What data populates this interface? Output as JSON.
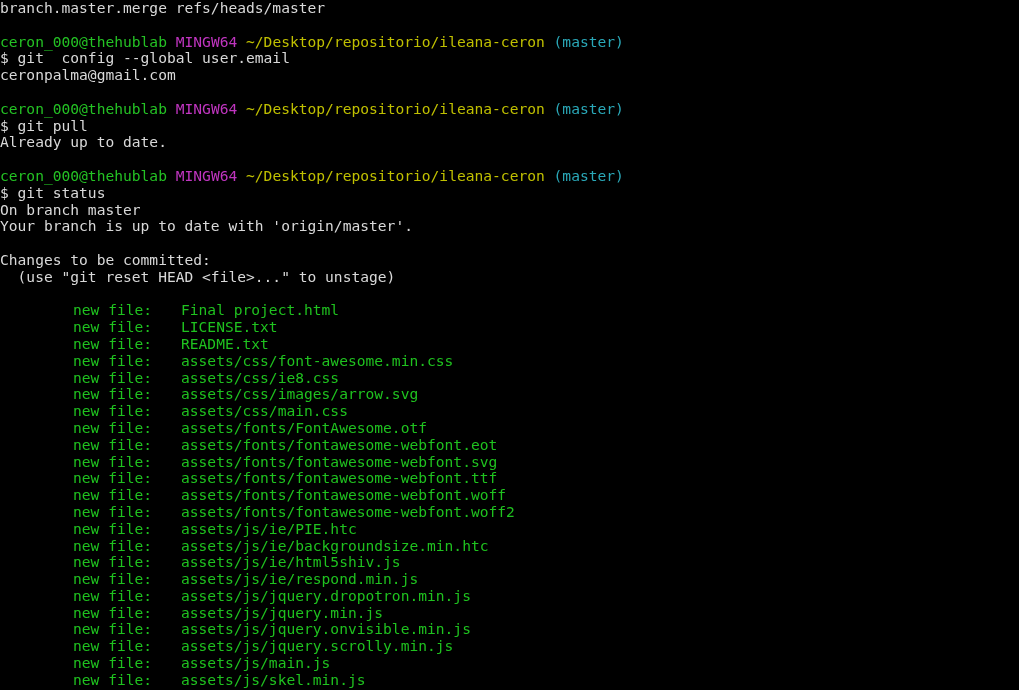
{
  "terminal": {
    "lines": [
      {
        "kind": "output",
        "text": "branch.master.merge refs/heads/master"
      },
      {
        "kind": "blank"
      },
      {
        "kind": "prompt",
        "user": "ceron_000@thehublab",
        "system": "MINGW64",
        "path": "~/Desktop/repositorio/ileana-ceron",
        "branch": "(master)"
      },
      {
        "kind": "command",
        "text": "$ git  config --global user.email"
      },
      {
        "kind": "output",
        "text": "ceronpalma@gmail.com"
      },
      {
        "kind": "blank"
      },
      {
        "kind": "prompt",
        "user": "ceron_000@thehublab",
        "system": "MINGW64",
        "path": "~/Desktop/repositorio/ileana-ceron",
        "branch": "(master)"
      },
      {
        "kind": "command",
        "text": "$ git pull"
      },
      {
        "kind": "output",
        "text": "Already up to date."
      },
      {
        "kind": "blank"
      },
      {
        "kind": "prompt",
        "user": "ceron_000@thehublab",
        "system": "MINGW64",
        "path": "~/Desktop/repositorio/ileana-ceron",
        "branch": "(master)"
      },
      {
        "kind": "command",
        "text": "$ git status"
      },
      {
        "kind": "output",
        "text": "On branch master"
      },
      {
        "kind": "output",
        "text": "Your branch is up to date with 'origin/master'."
      },
      {
        "kind": "blank"
      },
      {
        "kind": "output",
        "text": "Changes to be committed:"
      },
      {
        "kind": "output",
        "text": "  (use \"git reset HEAD <file>...\" to unstage)"
      },
      {
        "kind": "blank"
      },
      {
        "kind": "staged",
        "status": "new file:",
        "file": "Final project.html"
      },
      {
        "kind": "staged",
        "status": "new file:",
        "file": "LICENSE.txt"
      },
      {
        "kind": "staged",
        "status": "new file:",
        "file": "README.txt"
      },
      {
        "kind": "staged",
        "status": "new file:",
        "file": "assets/css/font-awesome.min.css"
      },
      {
        "kind": "staged",
        "status": "new file:",
        "file": "assets/css/ie8.css"
      },
      {
        "kind": "staged",
        "status": "new file:",
        "file": "assets/css/images/arrow.svg"
      },
      {
        "kind": "staged",
        "status": "new file:",
        "file": "assets/css/main.css"
      },
      {
        "kind": "staged",
        "status": "new file:",
        "file": "assets/fonts/FontAwesome.otf"
      },
      {
        "kind": "staged",
        "status": "new file:",
        "file": "assets/fonts/fontawesome-webfont.eot"
      },
      {
        "kind": "staged",
        "status": "new file:",
        "file": "assets/fonts/fontawesome-webfont.svg"
      },
      {
        "kind": "staged",
        "status": "new file:",
        "file": "assets/fonts/fontawesome-webfont.ttf"
      },
      {
        "kind": "staged",
        "status": "new file:",
        "file": "assets/fonts/fontawesome-webfont.woff"
      },
      {
        "kind": "staged",
        "status": "new file:",
        "file": "assets/fonts/fontawesome-webfont.woff2"
      },
      {
        "kind": "staged",
        "status": "new file:",
        "file": "assets/js/ie/PIE.htc"
      },
      {
        "kind": "staged",
        "status": "new file:",
        "file": "assets/js/ie/backgroundsize.min.htc"
      },
      {
        "kind": "staged",
        "status": "new file:",
        "file": "assets/js/ie/html5shiv.js"
      },
      {
        "kind": "staged",
        "status": "new file:",
        "file": "assets/js/ie/respond.min.js"
      },
      {
        "kind": "staged",
        "status": "new file:",
        "file": "assets/js/jquery.dropotron.min.js"
      },
      {
        "kind": "staged",
        "status": "new file:",
        "file": "assets/js/jquery.min.js"
      },
      {
        "kind": "staged",
        "status": "new file:",
        "file": "assets/js/jquery.onvisible.min.js"
      },
      {
        "kind": "staged",
        "status": "new file:",
        "file": "assets/js/jquery.scrolly.min.js"
      },
      {
        "kind": "staged",
        "status": "new file:",
        "file": "assets/js/main.js"
      },
      {
        "kind": "staged",
        "status": "new file:",
        "file": "assets/js/skel.min.js"
      }
    ]
  }
}
